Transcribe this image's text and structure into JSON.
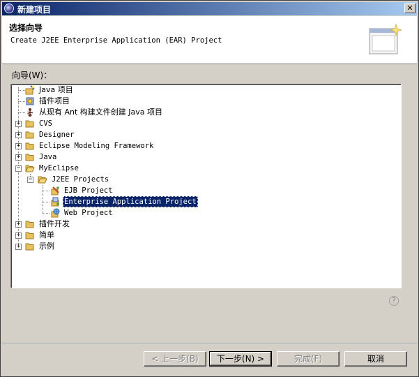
{
  "window": {
    "title": "新建项目"
  },
  "header": {
    "title": "选择向导",
    "description": "Create J2EE Enterprise Application (EAR) Project"
  },
  "tree_label": "向导(W)：",
  "tree": {
    "items": [
      {
        "label": "Java 项目"
      },
      {
        "label": "插件项目"
      },
      {
        "label": "从现有 Ant 构建文件创建 Java 项目"
      },
      {
        "label": "CVS"
      },
      {
        "label": "Designer"
      },
      {
        "label": "Eclipse Modeling Framework"
      },
      {
        "label": "Java"
      },
      {
        "label": "MyEclipse"
      },
      {
        "label": "J2EE Projects"
      },
      {
        "label": "EJB Project"
      },
      {
        "label": "Enterprise Application Project"
      },
      {
        "label": "Web Project"
      },
      {
        "label": "插件开发"
      },
      {
        "label": "简单"
      },
      {
        "label": "示例"
      }
    ]
  },
  "buttons": {
    "back": "< 上一步(B)",
    "next": "下一步(N) >",
    "finish": "完成(F)",
    "cancel": "取消"
  },
  "colors": {
    "title_bar": "#0a246a",
    "selection": "#0a246a",
    "folder": "#e8c25c"
  }
}
